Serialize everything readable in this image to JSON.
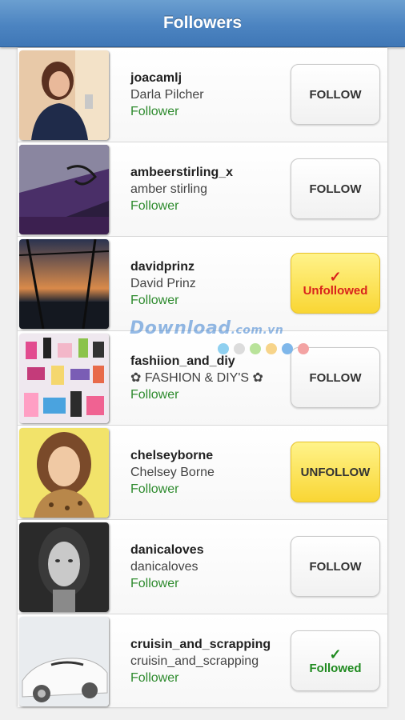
{
  "header": {
    "title": "Followers"
  },
  "followers": [
    {
      "username": "joacamlj",
      "fullname": "Darla Pilcher",
      "status": "Follower",
      "button": {
        "label": "FOLLOW",
        "check": "",
        "style": "follow"
      }
    },
    {
      "username": "ambeerstirling_x",
      "fullname": "amber stirling",
      "status": "Follower",
      "button": {
        "label": "FOLLOW",
        "check": "",
        "style": "follow"
      }
    },
    {
      "username": "davidprinz",
      "fullname": "David Prinz",
      "status": "Follower",
      "button": {
        "label": "Unfollowed",
        "check": "✓",
        "style": "unfollowed"
      }
    },
    {
      "username": "fashiion_and_diy",
      "fullname": "✿ FASHION & DIY'S ✿",
      "status": "Follower",
      "button": {
        "label": "FOLLOW",
        "check": "",
        "style": "follow"
      }
    },
    {
      "username": "chelseyborne",
      "fullname": "Chelsey Borne",
      "status": "Follower",
      "button": {
        "label": "UNFOLLOW",
        "check": "",
        "style": "unfollow"
      }
    },
    {
      "username": "danicaloves",
      "fullname": "danicaloves",
      "status": "Follower",
      "button": {
        "label": "FOLLOW",
        "check": "",
        "style": "follow"
      }
    },
    {
      "username": "cruisin_and_scrapping",
      "fullname": "cruisin_and_scrapping",
      "status": "Follower",
      "button": {
        "label": "Followed",
        "check": "✓",
        "style": "followed"
      }
    }
  ],
  "watermark": {
    "text": "Download",
    "suffix": ".com.vn",
    "dot_colors": [
      "#8fd0f0",
      "#dcdcdc",
      "#b9e39a",
      "#f7d48a",
      "#7fb7ea",
      "#f3a3a3"
    ]
  },
  "colors": {
    "header": "#4c84c1",
    "follower_status": "#2e8b2e",
    "yellow_button": "#f9d634",
    "unfollowed_text": "#d9231c",
    "followed_text": "#1f8a1f"
  }
}
